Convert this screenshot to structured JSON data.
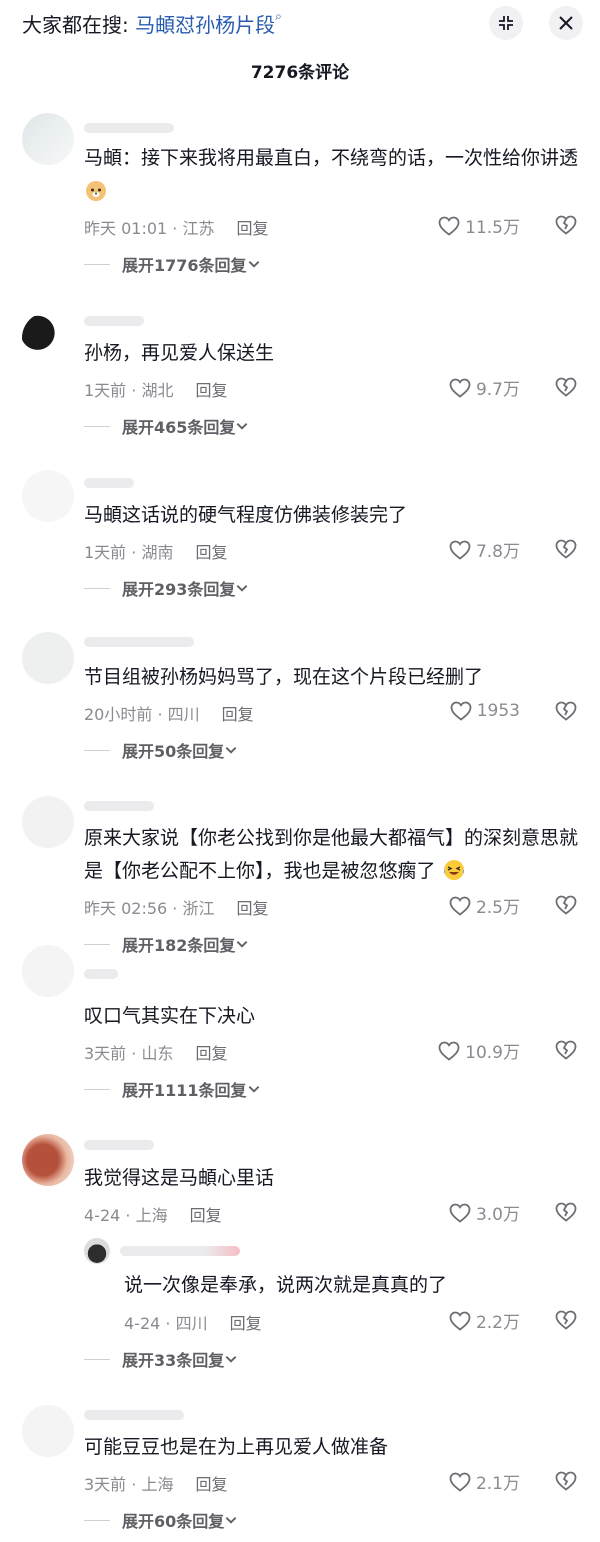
{
  "header": {
    "search_prefix": "大家都在搜: ",
    "search_term": "马頔怼孙杨片段",
    "comment_count": "7276条评论"
  },
  "comments": [
    {
      "text": "马頔：接下来我将用最直白，不绕弯的话，一次性给你讲透",
      "emoji": "emoji-dog-face",
      "time": "昨天 01:01 · 江苏",
      "reply": "回复",
      "likes": "11.5万",
      "expand": "展开1776条回复"
    },
    {
      "text": "孙杨，再见爱人保送生",
      "time": "1天前 · 湖北",
      "reply": "回复",
      "likes": "9.7万",
      "expand": "展开465条回复"
    },
    {
      "text": "马頔这话说的硬气程度仿佛装修装完了",
      "time": "1天前 · 湖南",
      "reply": "回复",
      "likes": "7.8万",
      "expand": "展开293条回复"
    },
    {
      "text": "节目组被孙杨妈妈骂了，现在这个片段已经删了",
      "time": "20小时前 · 四川",
      "reply": "回复",
      "likes": "1953",
      "expand": "展开50条回复"
    },
    {
      "text": "原来大家说【你老公找到你是他最大都福气】的深刻意思就是【你老公配不上你】，我也是被忽悠瘸了",
      "emoji": "emoji-laugh-cry",
      "time": "昨天 02:56 · 浙江",
      "reply": "回复",
      "likes": "2.5万",
      "expand": "展开182条回复"
    },
    {
      "text": "叹口气其实在下决心",
      "time": "3天前 · 山东",
      "reply": "回复",
      "likes": "10.9万",
      "expand": "展开1111条回复"
    },
    {
      "text": "我觉得这是马頔心里话",
      "time": "4-24 · 上海",
      "reply": "回复",
      "likes": "3.0万",
      "sub_reply": {
        "text": "说一次像是奉承，说两次就是真真的了",
        "time": "4-24 · 四川",
        "reply": "回复",
        "likes": "2.2万"
      },
      "expand": "展开33条回复"
    },
    {
      "text": "可能豆豆也是在为上再见爱人做准备",
      "time": "3天前 · 上海",
      "reply": "回复",
      "likes": "2.1万",
      "expand": "展开60条回复"
    }
  ],
  "colors": {
    "accent_link": "#2a5db0",
    "meta_gray": "#8a8b91",
    "text": "#161823"
  }
}
